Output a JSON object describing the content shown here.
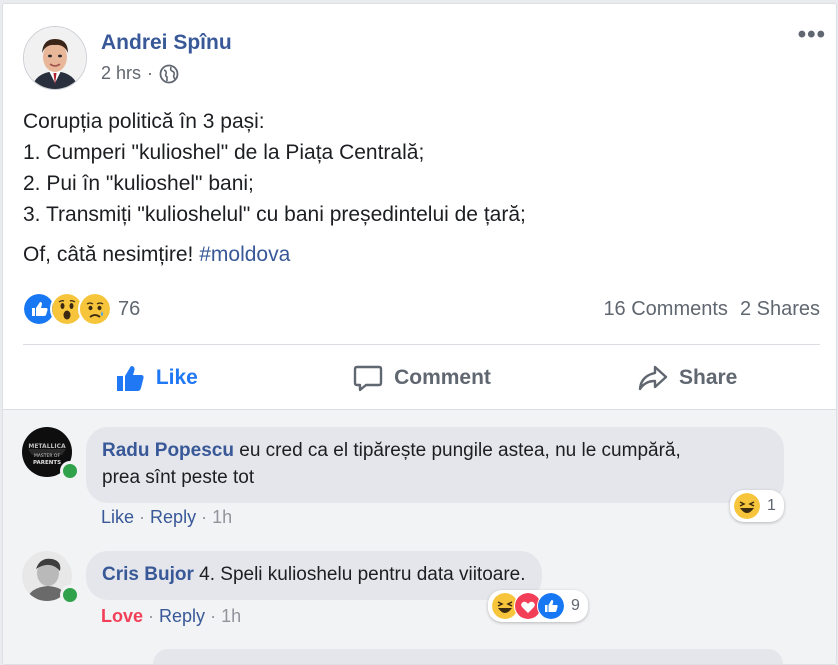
{
  "post": {
    "author": "Andrei Spînu",
    "time": "2 hrs",
    "dot": "·",
    "lines": [
      "Corupția politică în 3 pași:",
      "1. Cumperi \"kulioshel\" de la Piața Centrală;",
      "2. Pui în \"kulioshel\" bani;",
      "3. Transmiți \"kulioshelul\" cu bani președintelui de țară;"
    ],
    "closing_text": "Of, câtă nesimțire! ",
    "hashtag": "#moldova",
    "more_label": "•••"
  },
  "reactions": {
    "icons": [
      "like-icon",
      "wow-icon",
      "sad-icon"
    ],
    "count": "76",
    "comments": "16 Comments",
    "shares": "2 Shares"
  },
  "actions": {
    "like": "Like",
    "comment": "Comment",
    "share": "Share"
  },
  "colors": {
    "link": "#385898",
    "like_blue": "#2078f4",
    "love_red": "#f33e58",
    "online_green": "#31a24c"
  },
  "comments": [
    {
      "author": "Radu Popescu",
      "text_line1": "eu cred ca el tipărește pungile astea, nu le cumpără,",
      "text_line2": "prea sînt peste tot",
      "action_like": "Like",
      "action_reply": "Reply",
      "time": "1h",
      "reaction_icons": [
        "haha-icon"
      ],
      "reaction_count": "1"
    },
    {
      "author": "Cris Bujor",
      "text": "4. Speli kulioshelu pentru data viitoare.",
      "action_like": "Love",
      "action_reply": "Reply",
      "time": "1h",
      "reaction_icons": [
        "haha-icon",
        "love-icon",
        "like-icon"
      ],
      "reaction_count": "9"
    }
  ]
}
